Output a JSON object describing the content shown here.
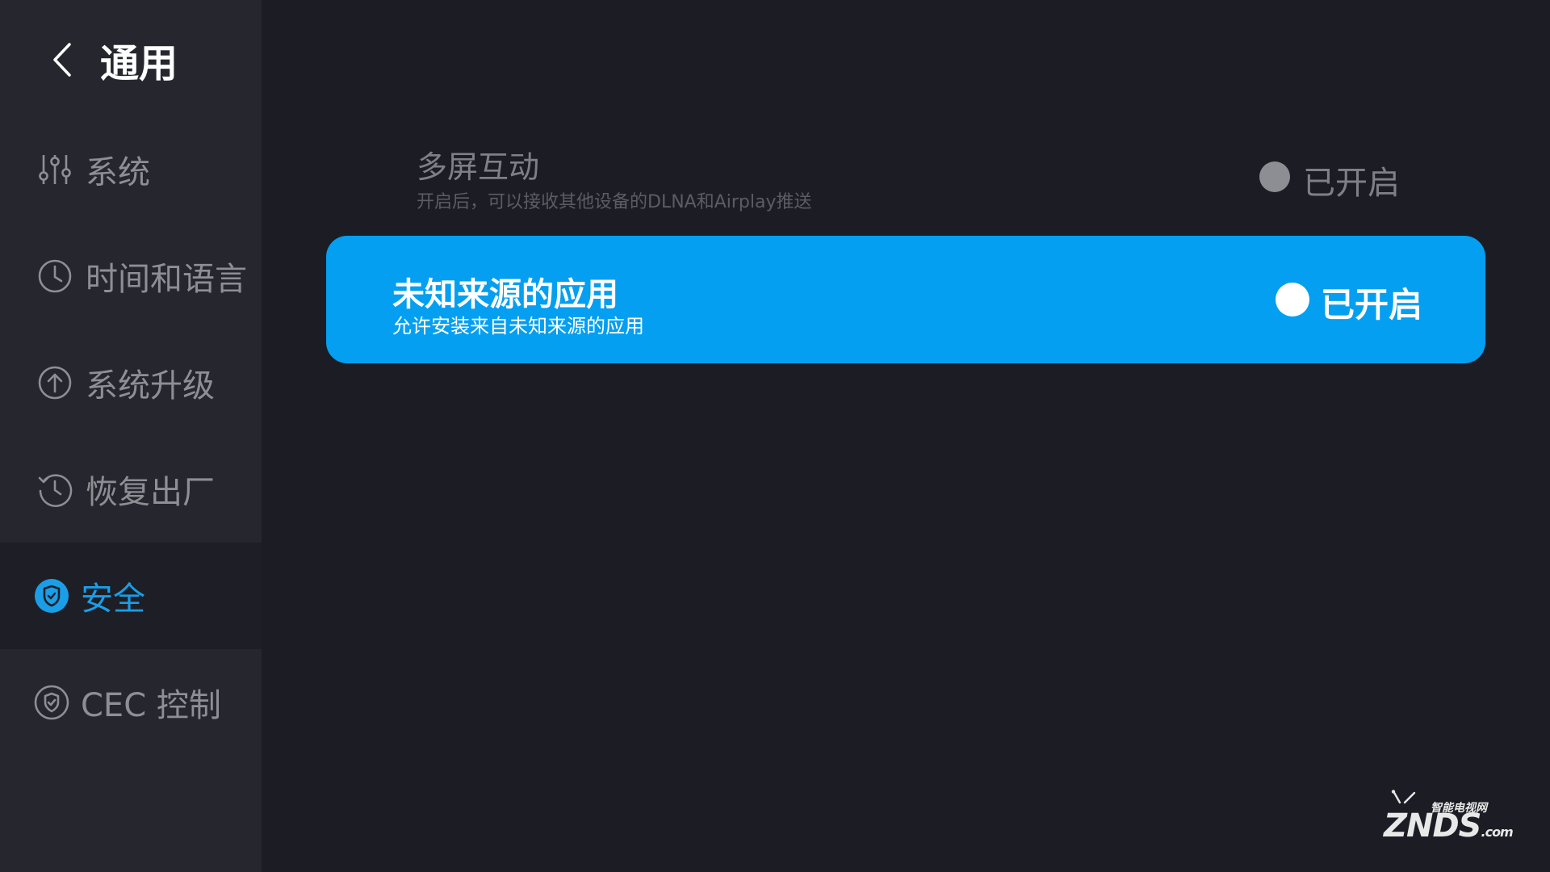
{
  "header": {
    "title": "通用"
  },
  "sidebar": {
    "items": [
      {
        "label": "系统",
        "icon": "sliders-icon"
      },
      {
        "label": "时间和语言",
        "icon": "clock-icon"
      },
      {
        "label": "系统升级",
        "icon": "upgrade-arrow-icon"
      },
      {
        "label": "恢复出厂",
        "icon": "history-icon"
      },
      {
        "label": "安全",
        "icon": "shield-icon",
        "active": true
      },
      {
        "label": "CEC 控制",
        "icon": "shield-outline-icon"
      }
    ]
  },
  "settings": [
    {
      "title": "多屏互动",
      "desc": "开启后，可以接收其他设备的DLNA和Airplay推送",
      "status": "已开启",
      "focused": false
    },
    {
      "title": "未知来源的应用",
      "desc": "允许安装来自未知来源的应用",
      "status": "已开启",
      "focused": true
    }
  ],
  "watermark": {
    "top": "智能电视网",
    "main": "ZNDS",
    "suffix": ".com"
  },
  "colors": {
    "accent": "#049ff0",
    "active_text": "#1a9ee8",
    "background": "#1c1d24",
    "sidebar": "#26272e"
  }
}
